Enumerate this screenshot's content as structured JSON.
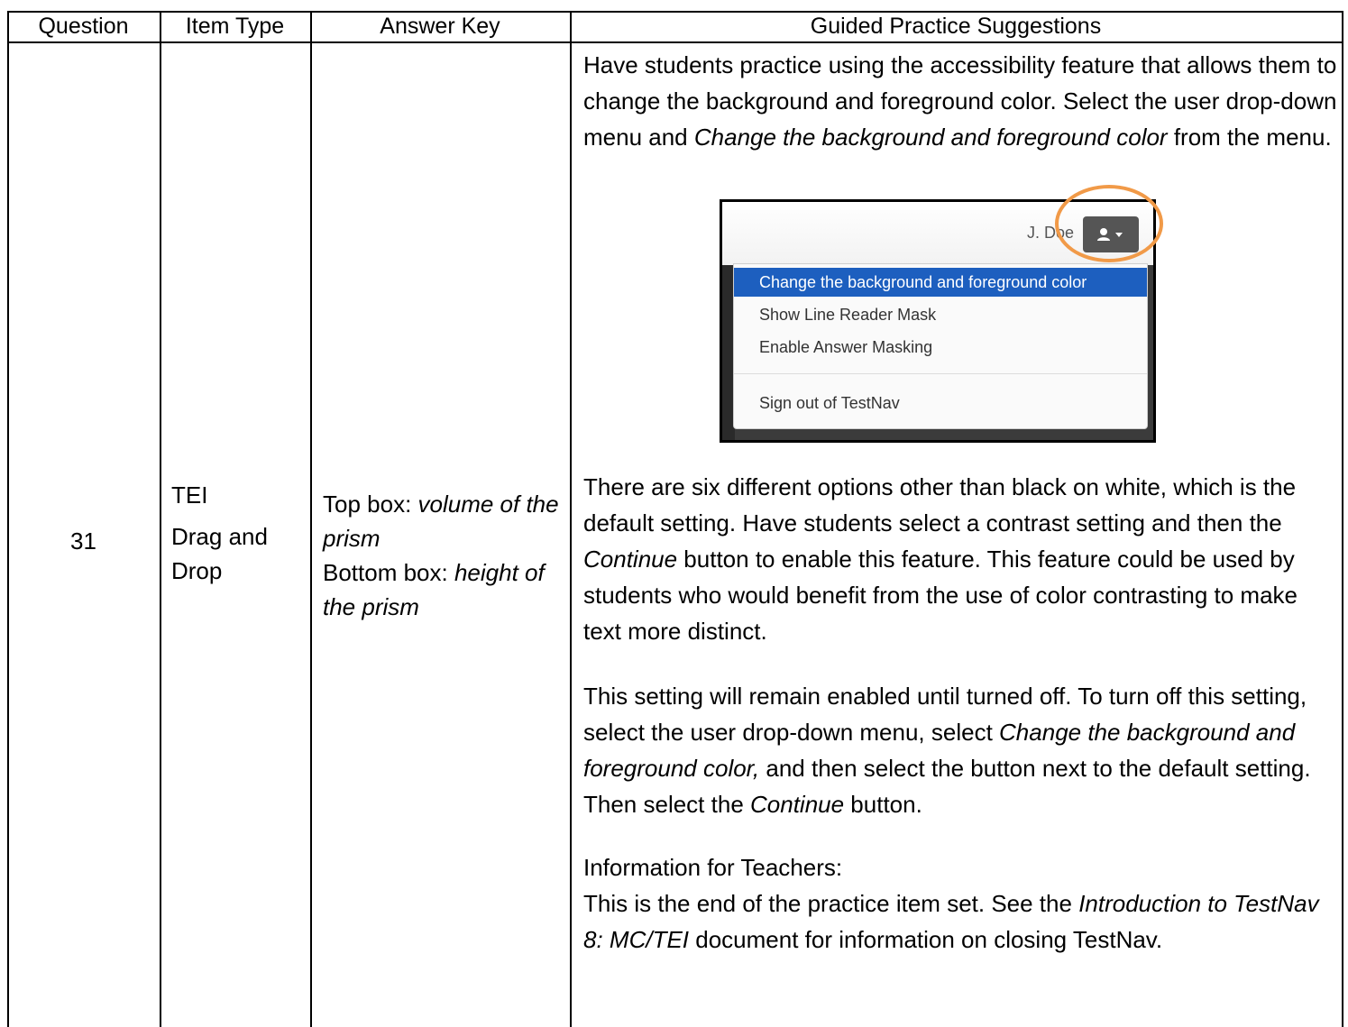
{
  "headers": {
    "question": "Question",
    "item_type": "Item Type",
    "answer_key": "Answer Key",
    "guided": "Guided Practice Suggestions"
  },
  "row": {
    "question": "31",
    "item_type_1": "TEI",
    "item_type_2": "Drag and Drop",
    "answer_key": {
      "top_label": "Top box: ",
      "top_value": "volume of the prism",
      "bottom_label": "Bottom box: ",
      "bottom_value": "height of the prism"
    },
    "guided": {
      "p1_a": "Have students practice using the accessibility feature that allows them to change the background and foreground color. Select the user drop-down menu and ",
      "p1_b": "Change the background and foreground color",
      "p1_c": " from the menu.",
      "p2_a": "There are six different options other than black on white, which is the default setting. Have students select a contrast setting and then the ",
      "p2_b": "Continue",
      "p2_c": " button to enable this feature. This feature could be used by students who would benefit from the use of color contrasting to make text more distinct.",
      "p3_a": "This setting will remain enabled until turned off. To turn off this setting, select the user drop-down menu, select ",
      "p3_b": "Change the background and foreground color,",
      "p3_c": " and then select the button next to the default setting. Then select the ",
      "p3_d": "Continue",
      "p3_e": " button.",
      "p4_heading": "Information for Teachers:",
      "p4_a": "This is the end of the practice item set. See the ",
      "p4_b": "Introduction to TestNav 8: MC/TEI",
      "p4_c": " document for information on closing TestNav."
    }
  },
  "screenshot": {
    "user_name": "J. Doe",
    "menu_items": [
      "Change the background and foreground color",
      "Show Line Reader Mask",
      "Enable Answer Masking",
      "Sign out of TestNav"
    ],
    "highlight_color": "#1d5fbf",
    "ring_color": "#f19a48",
    "icons": [
      "user-icon",
      "caret-down-icon"
    ]
  }
}
